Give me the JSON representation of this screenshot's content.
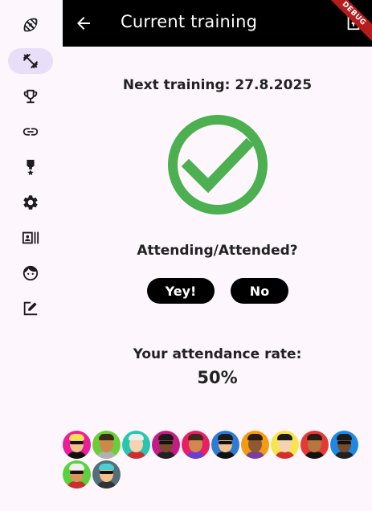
{
  "sidebar": {
    "items": [
      {
        "icon": "football-icon",
        "selected": false
      },
      {
        "icon": "fitness-icon",
        "selected": true
      },
      {
        "icon": "trophy-icon",
        "selected": false
      },
      {
        "icon": "link-icon",
        "selected": false
      },
      {
        "icon": "medal-icon",
        "selected": false
      },
      {
        "icon": "gear-icon",
        "selected": false
      },
      {
        "icon": "contact-list-icon",
        "selected": false
      },
      {
        "icon": "face-icon",
        "selected": false
      },
      {
        "icon": "edit-icon",
        "selected": false
      }
    ]
  },
  "appbar": {
    "title": "Current training",
    "back_icon": "arrow-left-icon",
    "action_icon": "export-icon",
    "debug_label": "DEBUG"
  },
  "main": {
    "next_training": "Next training: 27.8.2025",
    "status_icon": "check-circle-icon",
    "status_color": "#4caf50",
    "question": "Attending/Attended?",
    "yes_label": "Yey!",
    "no_label": "No",
    "rate_label": "Your attendance rate:",
    "rate_value": "50%"
  },
  "avatars": [
    {
      "bg": "#e91e9b",
      "skin": "#f2c28a",
      "hair": "#f7e04b",
      "shirt": "#111111",
      "glasses": true
    },
    {
      "bg": "#6ccd3a",
      "skin": "#c98a4b",
      "hair": "#3a2a1a",
      "shirt": "#b0b0b0",
      "glasses": false
    },
    {
      "bg": "#26c6b0",
      "skin": "#f4d4b0",
      "hair": "#eeeeee",
      "shirt": "#cc2d2d",
      "glasses": false
    },
    {
      "bg": "#c41c86",
      "skin": "#7a4a2a",
      "hair": "#1a1a1a",
      "shirt": "#222222",
      "glasses": true
    },
    {
      "bg": "#e91e63",
      "skin": "#d08850",
      "hair": "#3a2a1a",
      "shirt": "#6a3fd0",
      "glasses": false
    },
    {
      "bg": "#2e7bd6",
      "skin": "#f2c28a",
      "hair": "#1a1a1a",
      "shirt": "#111111",
      "glasses": true
    },
    {
      "bg": "#f39c12",
      "skin": "#8a5a30",
      "hair": "#2a1a10",
      "shirt": "#7b3fa0",
      "glasses": false
    },
    {
      "bg": "#f7e64b",
      "skin": "#f4d4b0",
      "hair": "#1a1a1a",
      "shirt": "#d32f2f",
      "glasses": false
    },
    {
      "bg": "#e53935",
      "skin": "#b5763f",
      "hair": "#2a1a10",
      "shirt": "#111111",
      "glasses": false
    },
    {
      "bg": "#1e88e5",
      "skin": "#7a4a2a",
      "hair": "#1a1a1a",
      "shirt": "#222222",
      "glasses": true
    },
    {
      "bg": "#5ad23a",
      "skin": "#d9955a",
      "hair": "#f0f0f0",
      "shirt": "#cc2d2d",
      "glasses": true
    },
    {
      "bg": "#546e7a",
      "skin": "#f2c28a",
      "hair": "#4ad0d0",
      "shirt": "#333333",
      "glasses": true
    }
  ]
}
